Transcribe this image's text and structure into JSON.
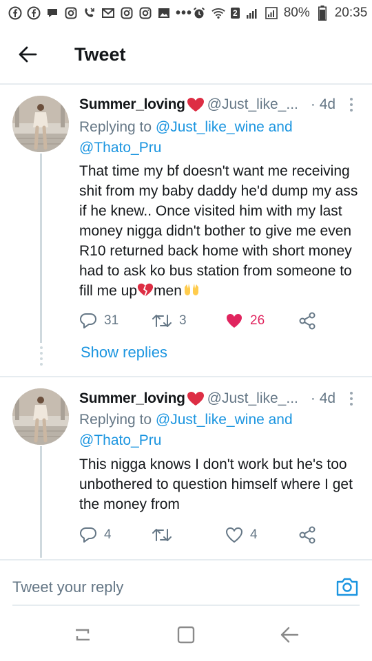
{
  "status_bar": {
    "battery": "80%",
    "time": "20:35",
    "sim_badge": "2",
    "more_dots": "•••"
  },
  "header": {
    "title": "Tweet"
  },
  "tweets": [
    {
      "name": "Summer_loving",
      "handle": "@Just_like_...",
      "time": "· 4d",
      "replying_to": "Replying to",
      "mention1": "@Just_like_wine",
      "and": " and",
      "mention2": "@Thato_Pru",
      "text": "That time my bf doesn't want me receiving shit from my baby daddy he'd dump my ass if he knew.. Once visited him with my last money nigga didn't bother to give me even R10 returned back home with short money had to ask ko bus station from someone to fill me up",
      "text_end": "men",
      "replies": "31",
      "retweets": "3",
      "likes": "26",
      "liked": true,
      "show_replies": "Show replies"
    },
    {
      "name": "Summer_loving",
      "handle": "@Just_like_...",
      "time": "· 4d",
      "replying_to": "Replying to",
      "mention1": "@Just_like_wine",
      "and": " and",
      "mention2": "@Thato_Pru",
      "text": "This nigga knows I don't work but he's too unbothered to question himself where I get the money from",
      "replies": "4",
      "retweets": "",
      "likes": "4",
      "liked": false
    }
  ],
  "reply_bar": {
    "placeholder": "Tweet your reply"
  },
  "colors": {
    "link": "#1b95e0",
    "secondary_text": "#657786",
    "like_red": "#e0245e",
    "divider": "#e6ecf0"
  }
}
